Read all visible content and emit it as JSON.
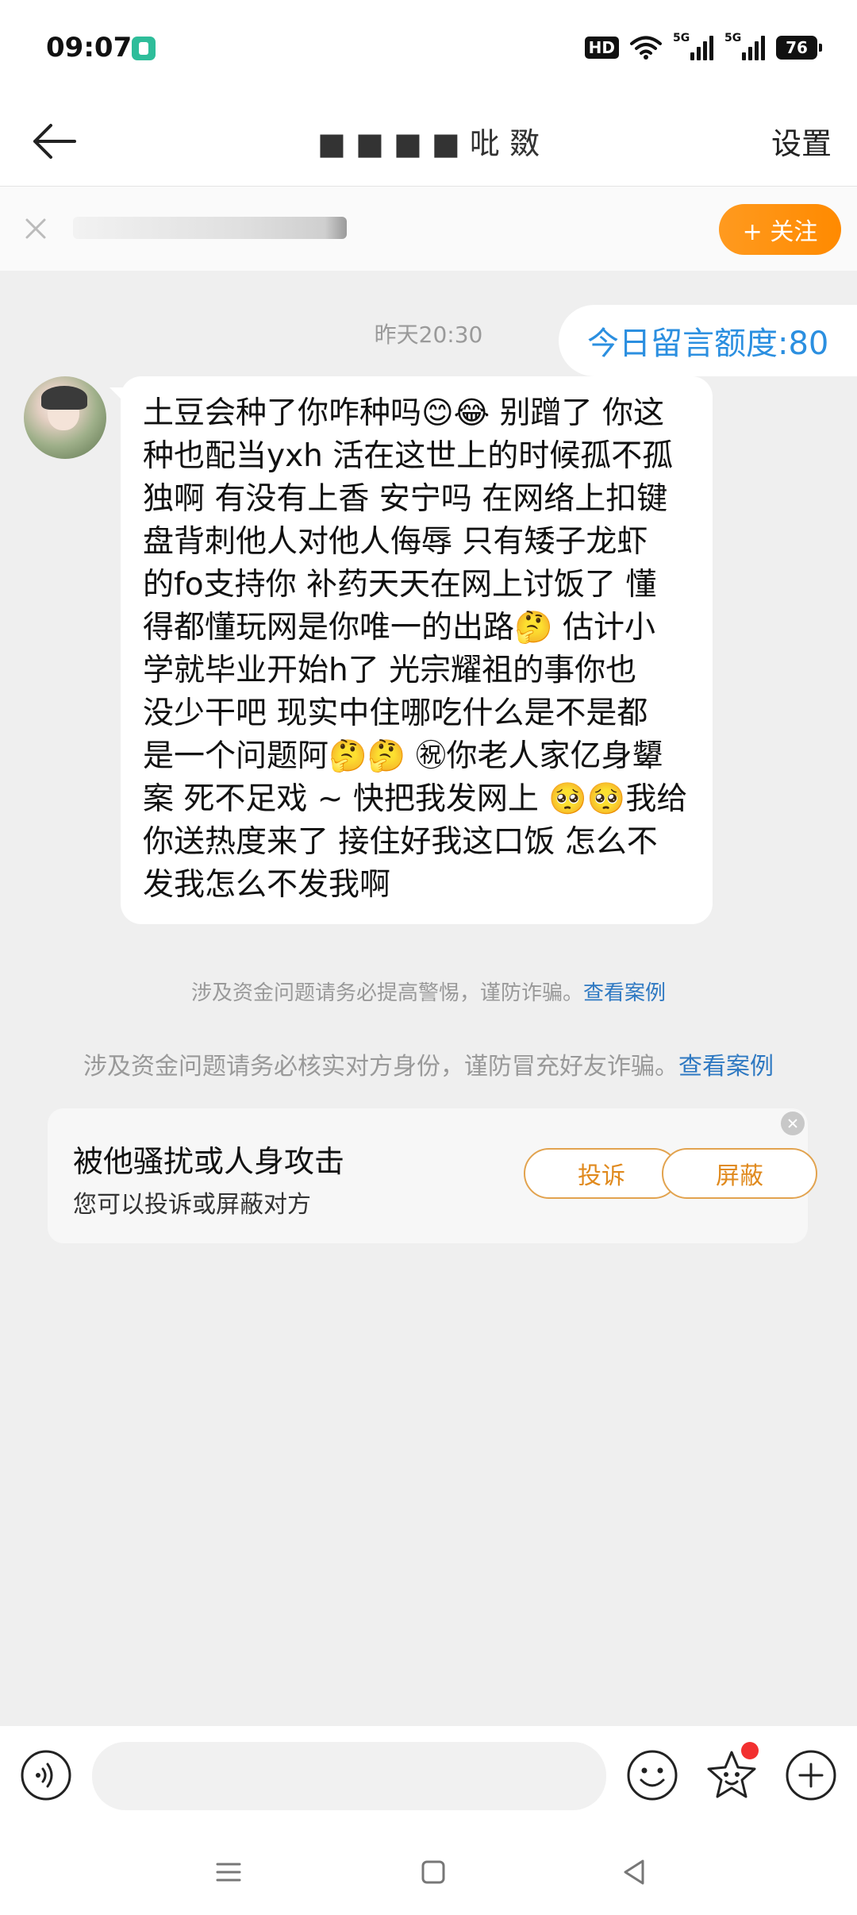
{
  "status_bar": {
    "time": "09:07",
    "hd_label": "HD",
    "signal_1_label": "5G",
    "signal_2_label": "5G",
    "battery": "76"
  },
  "header": {
    "title": "■ ■ ■ ■ 吡 敪",
    "settings_label": "设置"
  },
  "follow_banner": {
    "follow_label": "+ 关注"
  },
  "chat": {
    "timestamp": "昨天20:30",
    "quota": "今日留言额度:80",
    "message_lines": [
      "土豆会种了你咋种吗😊😂 别蹭了 你这",
      "种也配当yxh 活在这世上的时候孤不孤",
      "独啊 有没有上香 安宁吗 在网络上扣键",
      "盘背刺他人对他人侮辱 只有矮子龙虾",
      "的fo支持你  补药天天在网上讨饭了 懂",
      "得都懂玩网是你唯一的出路🤔 估计小",
      "学就毕业开始h了  光宗耀祖的事你也",
      "没少干吧 现实中住哪吃什么是不是都",
      "是一个问题阿🤔🤔 ㊗你老人家亿身顰",
      "案 死不足戏 ~  快把我发网上 🥺🥺我给",
      "你送热度来了 接住好我这口饭 怎么不",
      "发我怎么不发我啊"
    ]
  },
  "warnings": {
    "warning_1": "涉及资金问题请务必提高警惕，谨防诈骗。",
    "warning_1_link": "查看案例",
    "warning_2": "涉及资金问题请务必核实对方身份，谨防冒充好友诈骗。",
    "warning_2_link": "查看案例"
  },
  "report_card": {
    "title": "被他骚扰或人身攻击",
    "subtitle": "您可以投诉或屏蔽对方",
    "report_label": "投诉",
    "block_label": "屏蔽"
  },
  "input": {
    "placeholder": ""
  },
  "colors": {
    "accent_orange": "#ff8a00",
    "link_blue": "#2f79c2",
    "quota_blue": "#2b8fe0"
  }
}
